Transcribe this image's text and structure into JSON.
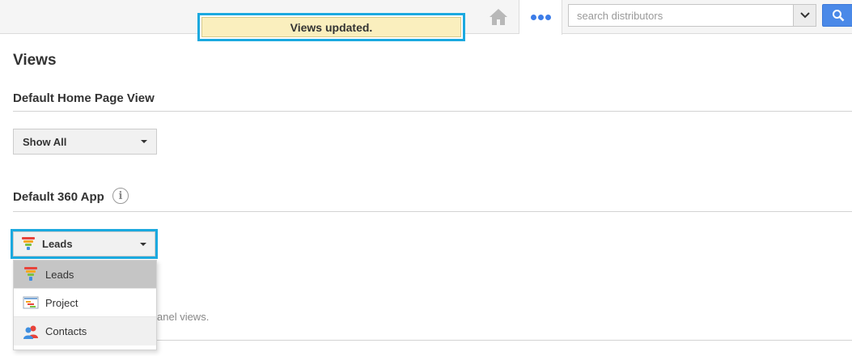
{
  "notification": {
    "message": "Views updated."
  },
  "header": {
    "search": {
      "placeholder": "search distributors",
      "value": ""
    },
    "home_icon": "home-icon",
    "more_icon": "ellipsis-icon",
    "search_icon": "magnifier-icon"
  },
  "page": {
    "title": "Views",
    "home_view": {
      "heading": "Default Home Page View",
      "selected": "Show All"
    },
    "app_360": {
      "heading": "Default 360 App",
      "info_glyph": "i",
      "selected": "Leads",
      "options": [
        {
          "label": "Leads",
          "icon": "funnel-icon",
          "state": "selected"
        },
        {
          "label": "Project",
          "icon": "project-icon",
          "state": "normal"
        },
        {
          "label": "Contacts",
          "icon": "contacts-icon",
          "state": "hover"
        }
      ]
    },
    "obscured_text": "anel views."
  },
  "colors": {
    "accent": "#1ba9df",
    "toast_bg": "#faefbe",
    "brand_blue": "#4a89e8"
  }
}
